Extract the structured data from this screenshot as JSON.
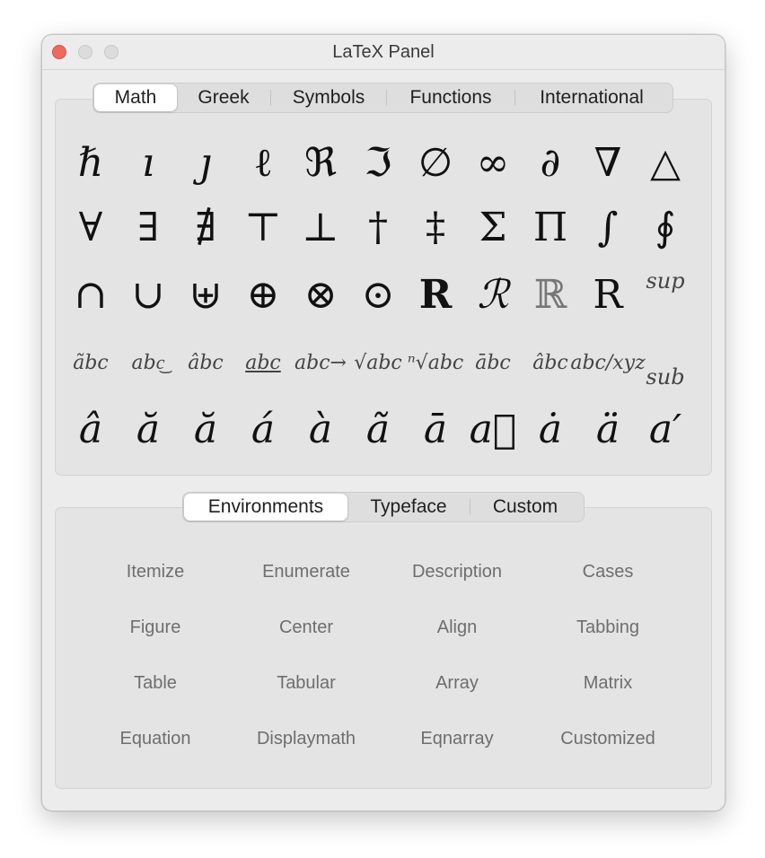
{
  "window": {
    "title": "LaTeX Panel"
  },
  "top_tabs": {
    "items": [
      "Math",
      "Greek",
      "Symbols",
      "Functions",
      "International"
    ],
    "selected": "Math"
  },
  "math_symbols": {
    "rows": [
      [
        "ℏ",
        "ı",
        "ȷ",
        "ℓ",
        "ℜ",
        "ℑ",
        "∅",
        "∞",
        "∂",
        "∇",
        "△"
      ],
      [
        "∀",
        "∃",
        "∄",
        "⊤",
        "⊥",
        "†",
        "‡",
        "Σ",
        "Π",
        "∫",
        "∮"
      ],
      [
        "∩",
        "∪",
        "⊎",
        "⊕",
        "⊗",
        "⊙",
        "R",
        "ℛ",
        "ℝ",
        "R",
        "sup"
      ],
      [
        "ãbc",
        "abc͜",
        "âbc",
        "abc",
        "abc→",
        "√abc",
        "ⁿ√abc",
        "ābc",
        "âbc",
        "abc/xyz",
        "sub"
      ],
      [
        "â",
        "ă",
        "ă",
        "á",
        "à",
        "ã",
        "ā",
        "a⃗",
        "ȧ",
        "ä",
        "a′"
      ]
    ]
  },
  "bottom_tabs": {
    "items": [
      "Environments",
      "Typeface",
      "Custom"
    ],
    "selected": "Environments"
  },
  "environments": {
    "items": [
      "Itemize",
      "Enumerate",
      "Description",
      "Cases",
      "Figure",
      "Center",
      "Align",
      "Tabbing",
      "Table",
      "Tabular",
      "Array",
      "Matrix",
      "Equation",
      "Displaymath",
      "Eqnarray",
      "Customized"
    ]
  }
}
